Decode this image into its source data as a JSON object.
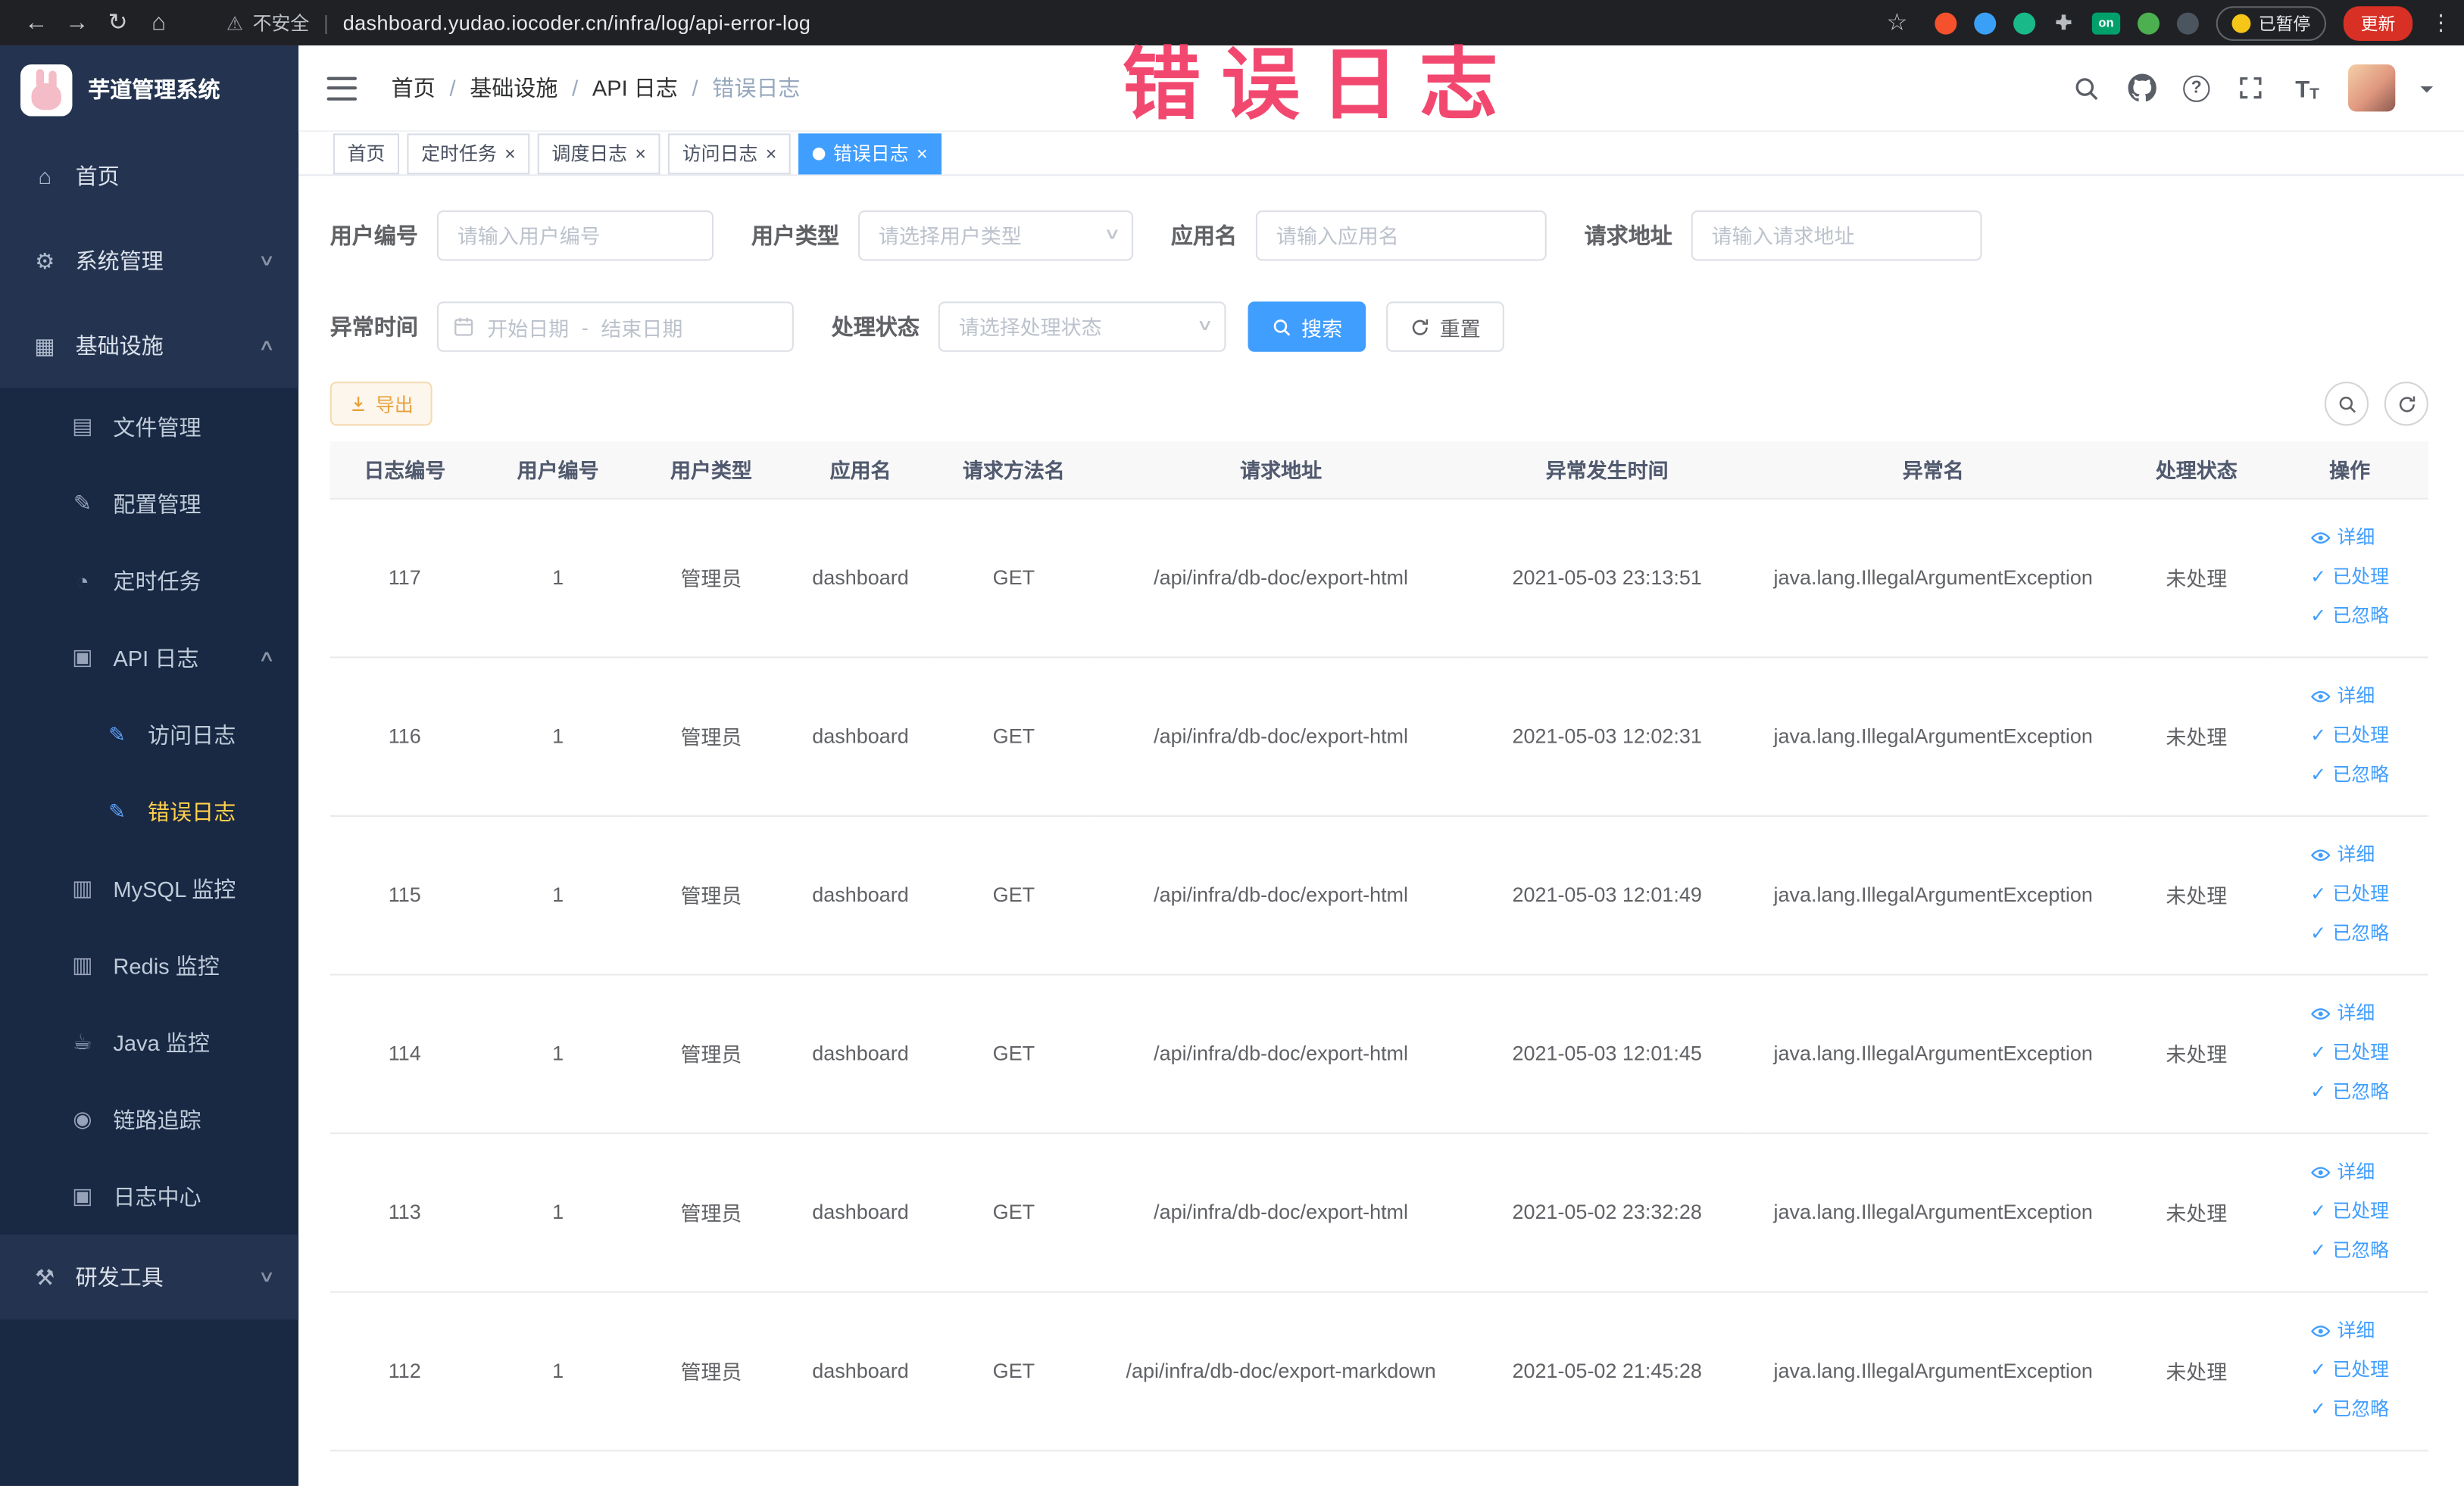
{
  "annotation": {
    "text": "错误日志"
  },
  "browser": {
    "security_label": "不安全",
    "url": "dashboard.yudao.iocoder.cn/infra/log/api-error-log",
    "extension_on_badge": "on",
    "paused_badge": "已暂停",
    "update_button": "更新"
  },
  "sidebar": {
    "logo_title": "芋道管理系统",
    "items": [
      {
        "id": "home",
        "label": "首页",
        "icon": "home-icon",
        "glyph": "home",
        "level": 1
      },
      {
        "id": "system",
        "label": "系统管理",
        "icon": "gear-icon",
        "glyph": "gear",
        "level": 1,
        "arrow": "down"
      },
      {
        "id": "infra",
        "label": "基础设施",
        "icon": "infra-icon",
        "glyph": "infra",
        "level": 1,
        "arrow": "up"
      },
      {
        "id": "file",
        "label": "文件管理",
        "icon": "file-manage-icon",
        "glyph": "file",
        "level": 2
      },
      {
        "id": "config",
        "label": "配置管理",
        "icon": "config-manage-icon",
        "glyph": "config",
        "level": 2
      },
      {
        "id": "job",
        "label": "定时任务",
        "icon": "timer-icon",
        "glyph": "timer",
        "level": 2
      },
      {
        "id": "api-log",
        "label": "API 日志",
        "icon": "api-log-icon",
        "glyph": "apilog",
        "level": 2,
        "arrow": "up"
      },
      {
        "id": "access-log",
        "label": "访问日志",
        "icon": "access-log-icon",
        "glyph": "pencil",
        "level": 3
      },
      {
        "id": "error-log",
        "label": "错误日志",
        "icon": "error-log-icon",
        "glyph": "pencil",
        "level": 3,
        "active": true
      },
      {
        "id": "mysql",
        "label": "MySQL 监控",
        "icon": "mysql-monitor-icon",
        "glyph": "mysql",
        "level": 2
      },
      {
        "id": "redis",
        "label": "Redis 监控",
        "icon": "redis-monitor-icon",
        "glyph": "redis",
        "level": 2
      },
      {
        "id": "java",
        "label": "Java 监控",
        "icon": "java-monitor-icon",
        "glyph": "java",
        "level": 2
      },
      {
        "id": "trace",
        "label": "链路追踪",
        "icon": "trace-icon",
        "glyph": "trace",
        "level": 2
      },
      {
        "id": "log-center",
        "label": "日志中心",
        "icon": "log-center-icon",
        "glyph": "logcenter",
        "level": 2
      },
      {
        "id": "dev-tools",
        "label": "研发工具",
        "icon": "tools-icon",
        "glyph": "tools",
        "level": 1,
        "arrow": "down"
      }
    ]
  },
  "navbar": {
    "breadcrumb": [
      "首页",
      "基础设施",
      "API 日志",
      "错误日志"
    ]
  },
  "tabs": [
    {
      "label": "首页",
      "closable": false,
      "active": false
    },
    {
      "label": "定时任务",
      "closable": true,
      "active": false
    },
    {
      "label": "调度日志",
      "closable": true,
      "active": false
    },
    {
      "label": "访问日志",
      "closable": true,
      "active": false
    },
    {
      "label": "错误日志",
      "closable": true,
      "active": true
    }
  ],
  "filters": {
    "user_id": {
      "label": "用户编号",
      "placeholder": "请输入用户编号"
    },
    "user_type": {
      "label": "用户类型",
      "placeholder": "请选择用户类型"
    },
    "app_name": {
      "label": "应用名",
      "placeholder": "请输入应用名"
    },
    "request_url": {
      "label": "请求地址",
      "placeholder": "请输入请求地址"
    },
    "exception_time": {
      "label": "异常时间",
      "start_placeholder": "开始日期",
      "separator": "-",
      "end_placeholder": "结束日期"
    },
    "process_status": {
      "label": "处理状态",
      "placeholder": "请选择处理状态"
    },
    "search_button": "搜索",
    "reset_button": "重置"
  },
  "toolbar": {
    "export_label": "导出"
  },
  "table": {
    "columns": [
      "日志编号",
      "用户编号",
      "用户类型",
      "应用名",
      "请求方法名",
      "请求地址",
      "异常发生时间",
      "异常名",
      "处理状态",
      "操作"
    ],
    "actions": [
      {
        "name": "detail",
        "label": "详细"
      },
      {
        "name": "processed",
        "label": "已处理"
      },
      {
        "name": "ignored",
        "label": "已忽略"
      }
    ],
    "rows": [
      {
        "id": "117",
        "user_id": "1",
        "user_type": "管理员",
        "app": "dashboard",
        "method": "GET",
        "url": "/api/infra/db-doc/export-html",
        "time": "2021-05-03 23:13:51",
        "exception": "java.lang.IllegalArgumentException",
        "status": "未处理"
      },
      {
        "id": "116",
        "user_id": "1",
        "user_type": "管理员",
        "app": "dashboard",
        "method": "GET",
        "url": "/api/infra/db-doc/export-html",
        "time": "2021-05-03 12:02:31",
        "exception": "java.lang.IllegalArgumentException",
        "status": "未处理"
      },
      {
        "id": "115",
        "user_id": "1",
        "user_type": "管理员",
        "app": "dashboard",
        "method": "GET",
        "url": "/api/infra/db-doc/export-html",
        "time": "2021-05-03 12:01:49",
        "exception": "java.lang.IllegalArgumentException",
        "status": "未处理"
      },
      {
        "id": "114",
        "user_id": "1",
        "user_type": "管理员",
        "app": "dashboard",
        "method": "GET",
        "url": "/api/infra/db-doc/export-html",
        "time": "2021-05-03 12:01:45",
        "exception": "java.lang.IllegalArgumentException",
        "status": "未处理"
      },
      {
        "id": "113",
        "user_id": "1",
        "user_type": "管理员",
        "app": "dashboard",
        "method": "GET",
        "url": "/api/infra/db-doc/export-html",
        "time": "2021-05-02 23:32:28",
        "exception": "java.lang.IllegalArgumentException",
        "status": "未处理"
      },
      {
        "id": "112",
        "user_id": "1",
        "user_type": "管理员",
        "app": "dashboard",
        "method": "GET",
        "url": "/api/infra/db-doc/export-markdown",
        "time": "2021-05-02 21:45:28",
        "exception": "java.lang.IllegalArgumentException",
        "status": "未处理"
      }
    ]
  }
}
